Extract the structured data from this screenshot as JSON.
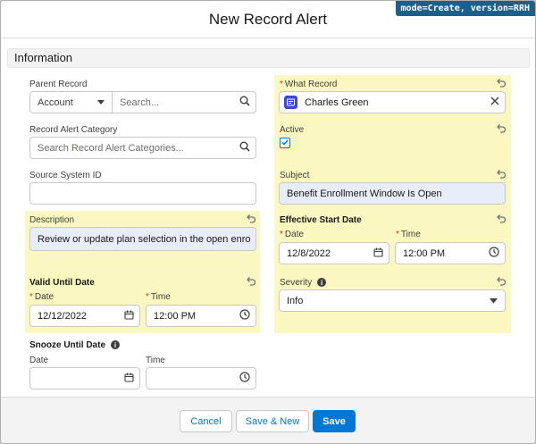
{
  "header": {
    "title": "New Record Alert",
    "mode_badge": "mode=Create, version=RRH"
  },
  "section": {
    "title": "Information"
  },
  "fields": {
    "parent_record": {
      "label": "Parent Record",
      "type_value": "Account",
      "placeholder": "Search..."
    },
    "category": {
      "label": "Record Alert Category",
      "placeholder": "Search Record Alert Categories..."
    },
    "source_id": {
      "label": "Source System ID",
      "value": ""
    },
    "description": {
      "label": "Description",
      "value": "Review or update plan selection in the open enro"
    },
    "valid_until": {
      "title": "Valid Until Date",
      "date_label": "Date",
      "date_value": "12/12/2022",
      "time_label": "Time",
      "time_value": "12:00 PM"
    },
    "snooze_until": {
      "title": "Snooze Until Date",
      "date_label": "Date",
      "date_value": "",
      "time_label": "Time",
      "time_value": ""
    },
    "what_record": {
      "label": "What Record",
      "value": "Charles Green"
    },
    "active": {
      "label": "Active",
      "checked": true
    },
    "subject": {
      "label": "Subject",
      "value": "Benefit Enrollment Window Is Open"
    },
    "effective_start": {
      "title": "Effective Start Date",
      "date_label": "Date",
      "date_value": "12/8/2022",
      "time_label": "Time",
      "time_value": "12:00 PM"
    },
    "severity": {
      "label": "Severity",
      "value": "Info"
    }
  },
  "footer": {
    "cancel_label": "Cancel",
    "save_new_label": "Save & New",
    "save_label": "Save"
  },
  "colors": {
    "accent": "#0176d3",
    "highlight": "#faf8c0",
    "required": "#c23934",
    "badge": "#1b5f8c"
  },
  "icons": [
    "search-icon",
    "calendar-icon",
    "clock-icon",
    "undo-icon",
    "info-icon",
    "clear-icon",
    "chevron-down-icon",
    "record-icon",
    "check-icon"
  ]
}
